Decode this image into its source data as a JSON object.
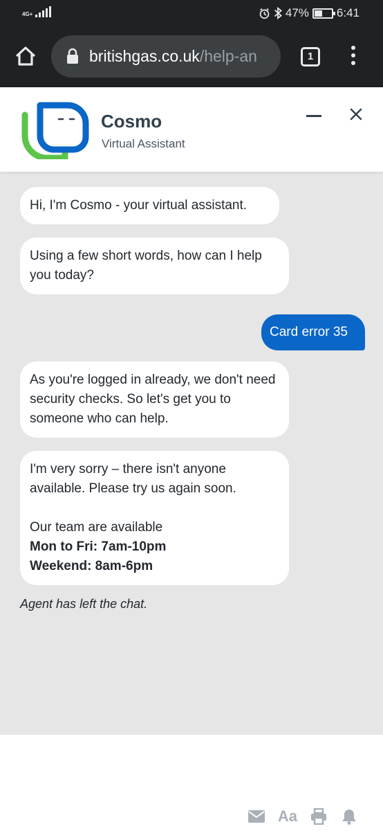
{
  "status_bar": {
    "network": "4G+",
    "battery": "47%",
    "battery_level": 0.47,
    "time": "6:41"
  },
  "browser": {
    "url_domain": "britishgas.co.uk",
    "url_path": "/help-an",
    "tab_count": "1"
  },
  "chat_header": {
    "name": "Cosmo",
    "subtitle": "Virtual Assistant"
  },
  "messages": [
    {
      "from": "bot",
      "text": "Hi, I'm Cosmo - your virtual assistant."
    },
    {
      "from": "bot",
      "text": "Using a few short words, how can I help you today?"
    },
    {
      "from": "user",
      "text": "Card error 35"
    },
    {
      "from": "bot",
      "text": "As you're logged in already, we don't need security checks. So let's get you to someone who can help."
    },
    {
      "from": "bot",
      "text": "I'm very sorry – there isn't anyone available. Please try us again soon.",
      "text2": "Our team are available",
      "hours_weekday": "Mon to Fri: 7am-10pm",
      "hours_weekend": "Weekend: 8am-6pm"
    }
  ],
  "system_note": "Agent has left the chat.",
  "footer": {
    "font_label": "Aa"
  },
  "colors": {
    "brand_blue": "#0a66c7",
    "chat_bg": "#e6e6e6",
    "logo_green": "#5cc44a"
  }
}
